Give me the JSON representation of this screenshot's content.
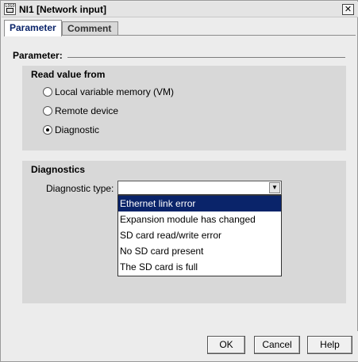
{
  "window": {
    "title": "NI1 [Network input]",
    "close_glyph": "✕",
    "icon_text": "LOGO"
  },
  "tabs": [
    {
      "label": "Parameter",
      "active": true
    },
    {
      "label": "Comment",
      "active": false
    }
  ],
  "parameter": {
    "section_label": "Parameter:",
    "read_value_group": {
      "title": "Read value from",
      "options": [
        {
          "label": "Local variable memory (VM)",
          "selected": false
        },
        {
          "label": "Remote device",
          "selected": false
        },
        {
          "label": "Diagnostic",
          "selected": true
        }
      ]
    },
    "diagnostics_group": {
      "title": "Diagnostics",
      "type_label": "Diagnostic type:",
      "combo_value": "",
      "options": [
        {
          "label": "Ethernet link error",
          "highlighted": true
        },
        {
          "label": "Expansion module has changed",
          "highlighted": false
        },
        {
          "label": "SD card read/write error",
          "highlighted": false
        },
        {
          "label": "No SD card present",
          "highlighted": false
        },
        {
          "label": "The SD card is full",
          "highlighted": false
        }
      ]
    }
  },
  "buttons": {
    "ok": "OK",
    "cancel": "Cancel",
    "help": "Help"
  },
  "colors": {
    "selection": "#0a246a",
    "group_background": "#d8d8d8",
    "window_background": "#ececec"
  }
}
